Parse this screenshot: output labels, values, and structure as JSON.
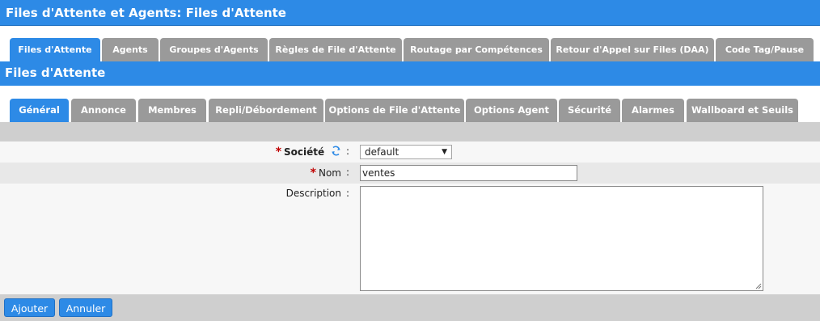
{
  "window": {
    "title": "Files d'Attente et Agents:  Files d'Attente"
  },
  "main_tabs": [
    {
      "label": "Files d'Attente",
      "active": true
    },
    {
      "label": "Agents"
    },
    {
      "label": "Groupes d'Agents"
    },
    {
      "label": "Règles de File d'Attente"
    },
    {
      "label": "Routage par Compétences"
    },
    {
      "label": "Retour d'Appel sur Files (DAA)"
    },
    {
      "label": "Code Tag/Pause"
    }
  ],
  "section": {
    "title": "Files d'Attente"
  },
  "sub_tabs": [
    {
      "label": "Général",
      "active": true
    },
    {
      "label": "Annonce"
    },
    {
      "label": "Membres"
    },
    {
      "label": "Repli/Débordement"
    },
    {
      "label": "Options de File d'Attente"
    },
    {
      "label": "Options Agent"
    },
    {
      "label": "Sécurité"
    },
    {
      "label": "Alarmes"
    },
    {
      "label": "Wallboard et Seuils"
    }
  ],
  "form": {
    "required_mark": "*",
    "colon": ":",
    "societe": {
      "label": "Société",
      "value": "default"
    },
    "nom": {
      "label": "Nom",
      "value": "ventes"
    },
    "description": {
      "label": "Description",
      "value": ""
    }
  },
  "actions": {
    "add_label": "Ajouter",
    "cancel_label": "Annuler"
  },
  "colors": {
    "accent": "#2d8ae6",
    "tab_inactive": "#9a9a9a",
    "required": "#c00000"
  }
}
